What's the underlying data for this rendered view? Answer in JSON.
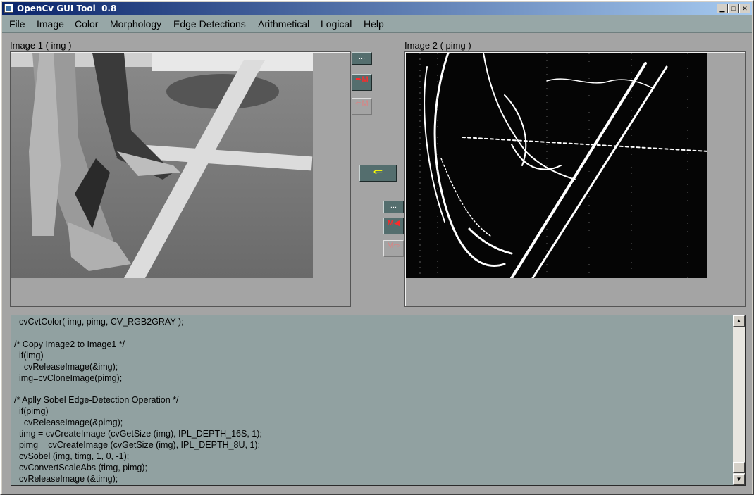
{
  "window": {
    "title": "OpenCv GUI Tool  0.8"
  },
  "menu": [
    "File",
    "Image",
    "Color",
    "Morphology",
    "Edge Detections",
    "Arithmetical",
    "Logical",
    "Help"
  ],
  "image1": {
    "label": "Image 1 ( img )"
  },
  "image2": {
    "label": "Image 2 ( pimg )"
  },
  "buttons": {
    "browse1": "...",
    "save1": "M",
    "load1": "M",
    "copy_to_image1": "⇐",
    "browse2": "...",
    "save2": "M",
    "load2": "M"
  },
  "code_lines": [
    "  cvCvtColor( img, pimg, CV_RGB2GRAY );",
    "",
    "/* Copy Image2 to Image1 */",
    "  if(img)",
    "    cvReleaseImage(&img);",
    "  img=cvCloneImage(pimg);",
    "",
    "/* Aplly Sobel Edge-Detection Operation */",
    "  if(pimg)",
    "    cvReleaseImage(&pimg);",
    "  timg = cvCreateImage (cvGetSize (img), IPL_DEPTH_16S, 1);",
    "  pimg = cvCreateImage (cvGetSize (img), IPL_DEPTH_8U, 1);",
    "  cvSobel (img, timg, 1, 0, -1);",
    "  cvConvertScaleAbs (timg, pimg);",
    "  cvReleaseImage (&timg);"
  ],
  "colors": {
    "titlebar": "#0a246a",
    "menubar": "#97a7a7",
    "panel": "#a4a4a4",
    "editor": "#91a1a1"
  }
}
